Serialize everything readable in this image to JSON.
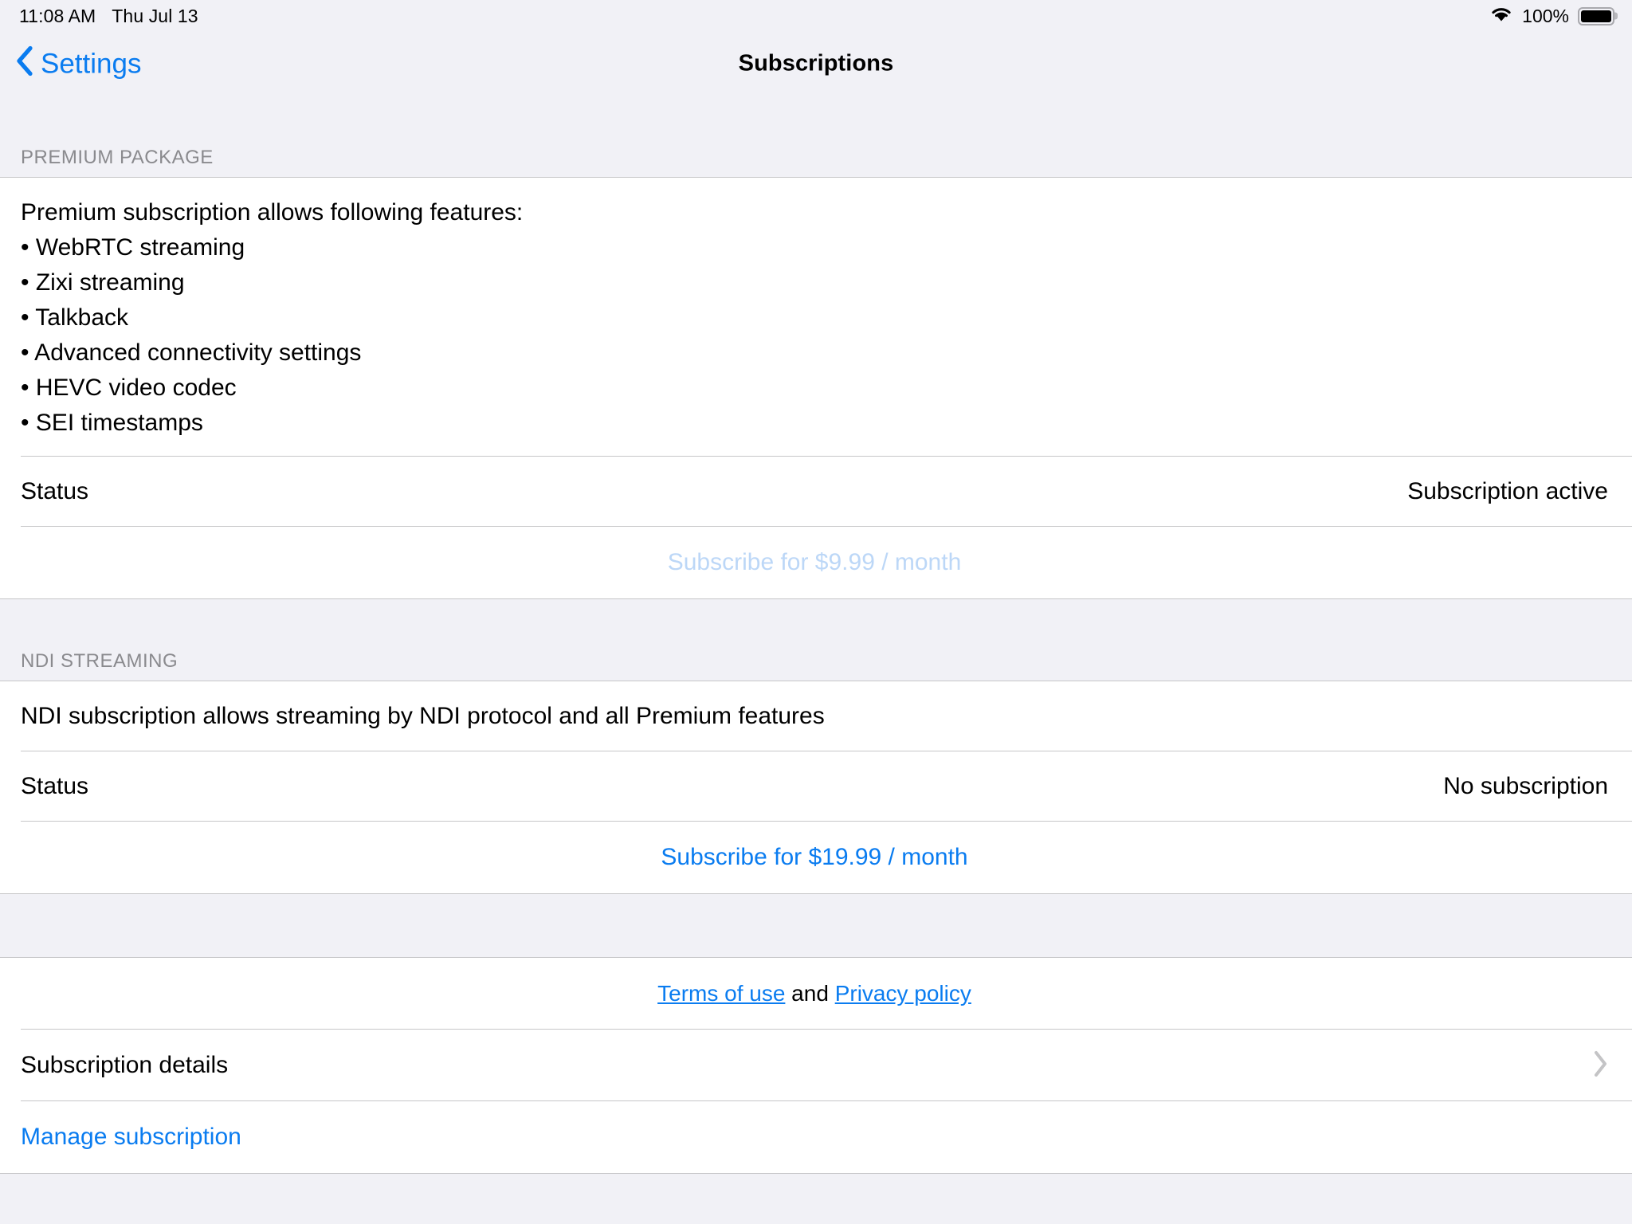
{
  "status_bar": {
    "time": "11:08 AM",
    "date": "Thu Jul 13",
    "wifi_icon": "wifi-icon",
    "battery_percent": "100%",
    "battery_icon": "battery-full-icon"
  },
  "nav": {
    "back_label": "Settings",
    "back_icon": "chevron-left-icon",
    "title": "Subscriptions"
  },
  "premium_section": {
    "header": "PREMIUM PACKAGE",
    "features_intro": "Premium subscription allows following features:",
    "features": [
      "• WebRTC streaming",
      "• Zixi streaming",
      "• Talkback",
      "• Advanced connectivity settings",
      "• HEVC video codec",
      "• SEI timestamps"
    ],
    "status_label": "Status",
    "status_value": "Subscription active",
    "subscribe_label": "Subscribe for $9.99 / month",
    "subscribe_disabled": true
  },
  "ndi_section": {
    "header": "NDI STREAMING",
    "description": "NDI subscription allows streaming by NDI protocol and all Premium features",
    "status_label": "Status",
    "status_value": "No subscription",
    "subscribe_label": "Subscribe for $19.99 / month",
    "subscribe_disabled": false
  },
  "footer_section": {
    "terms_label": "Terms of use",
    "and_label": " and ",
    "privacy_label": "Privacy policy",
    "details_label": "Subscription details",
    "details_chevron_icon": "chevron-right-icon",
    "manage_label": "Manage subscription"
  },
  "colors": {
    "accent_blue": "#0a7cf0",
    "disabled_blue": "#bcd7f7",
    "group_background": "#f1f1f6",
    "cell_background": "#ffffff",
    "separator": "#c6c6c8",
    "header_text": "#8a8a8e"
  }
}
